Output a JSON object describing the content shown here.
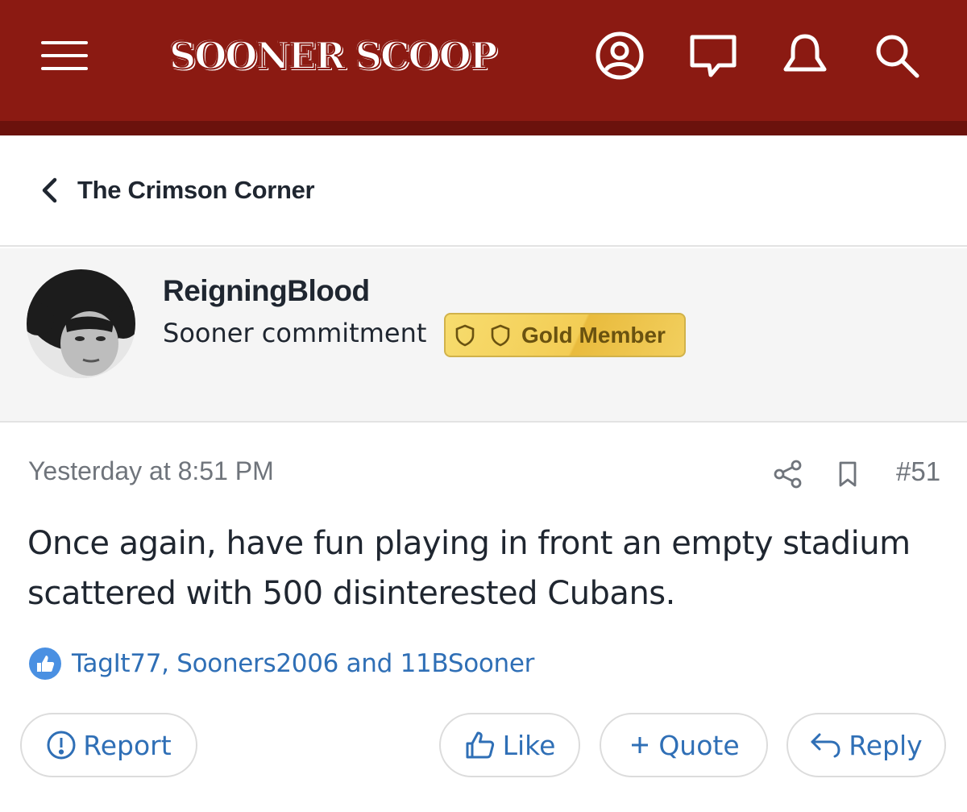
{
  "header": {
    "logo_text": "SOONER SCOOP",
    "background_color": "#8b1a12",
    "icons": [
      "menu-icon",
      "account-icon",
      "messages-icon",
      "alerts-icon",
      "search-icon"
    ]
  },
  "breadcrumb": {
    "label": "The Crimson Corner"
  },
  "author": {
    "username": "ReigningBlood",
    "title": "Sooner commitment",
    "badge": "Gold Member"
  },
  "post": {
    "timestamp": "Yesterday at 8:51 PM",
    "number": "#51",
    "body": "Once again, have fun playing in front an empty stadium scattered with 500 disinterested Cubans.",
    "reactions": "TagIt77, Sooners2006 and 11BSooner",
    "link_color": "#2f6fb6"
  },
  "actions": {
    "report": "Report",
    "like": "Like",
    "quote": "Quote",
    "reply": "Reply"
  }
}
